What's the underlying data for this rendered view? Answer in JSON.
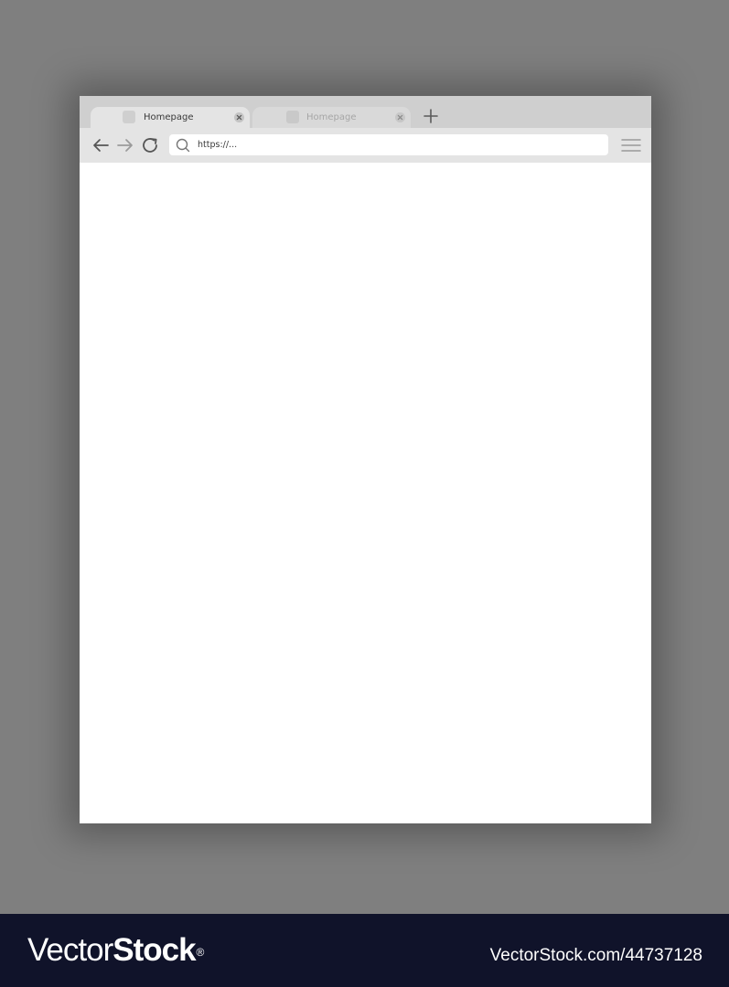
{
  "browser": {
    "tabs": [
      {
        "label": "Homepage",
        "active": true
      },
      {
        "label": "Homepage",
        "active": false
      }
    ],
    "new_tab_icon": "plus-icon",
    "nav": {
      "back_icon": "arrow-left-icon",
      "forward_icon": "arrow-right-icon",
      "reload_icon": "reload-icon"
    },
    "address_bar": {
      "icon": "search-icon",
      "url": "https://..."
    },
    "menu_icon": "hamburger-menu-icon"
  },
  "footer": {
    "brand_light": "Vector",
    "brand_bold": "Stock",
    "brand_mark": "®",
    "image_id": "VectorStock.com/44737128"
  },
  "colors": {
    "backdrop": "#7f7f7f",
    "tabstrip": "#cfcfcf",
    "active_tab": "#e4e4e4",
    "inactive_tab": "#d9d9d9",
    "toolbar": "#e4e4e4",
    "viewport": "#ffffff",
    "footer": "#10132a"
  }
}
